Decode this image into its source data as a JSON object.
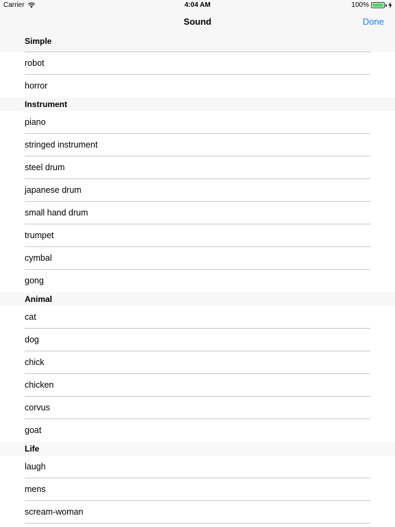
{
  "status_bar": {
    "carrier": "Carrier",
    "time": "4:04 AM",
    "battery_percent": "100%"
  },
  "nav_bar": {
    "title": "Sound",
    "done_label": "Done"
  },
  "sections": [
    {
      "header": "Simple",
      "items": [
        "robot",
        "horror"
      ]
    },
    {
      "header": "Instrument",
      "items": [
        "piano",
        "stringed instrument",
        "steel drum",
        "japanese drum",
        "small hand drum",
        "trumpet",
        "cymbal",
        "gong"
      ]
    },
    {
      "header": "Animal",
      "items": [
        "cat",
        "dog",
        "chick",
        "chicken",
        "corvus",
        "goat"
      ]
    },
    {
      "header": "Life",
      "items": [
        "laugh",
        "mens",
        "scream-woman"
      ]
    }
  ],
  "colors": {
    "accent": "#157efb",
    "battery": "#4cd964",
    "separator": "#c8c7cc",
    "header_bg": "#f7f7f7"
  }
}
